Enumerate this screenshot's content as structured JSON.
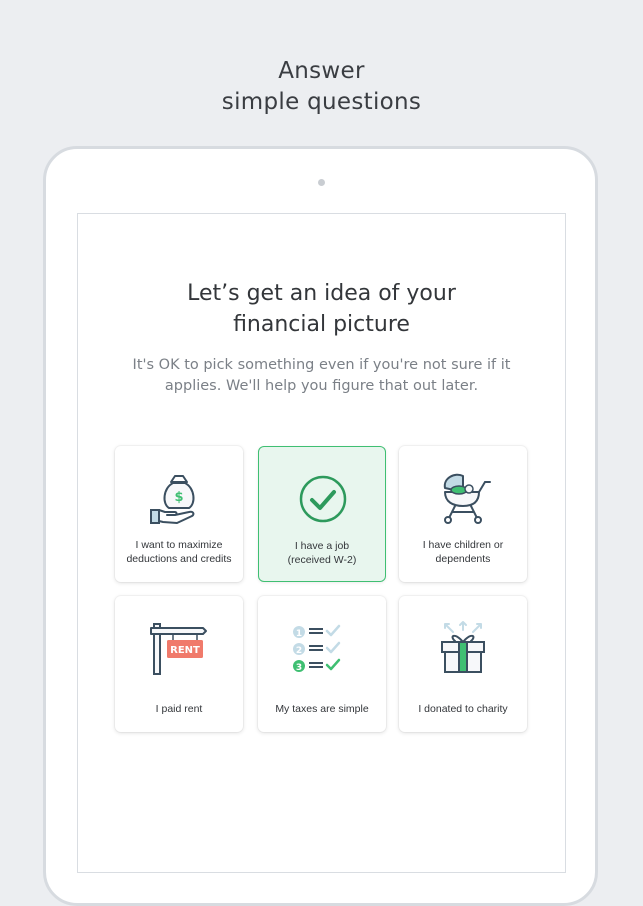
{
  "promo": {
    "title_line1": "Answer",
    "title_line2": "simple questions"
  },
  "screen": {
    "heading_line1": "Let’s get an idea of your",
    "heading_line2": "financial picture",
    "subtext_line1": "It's OK to pick something even if you're not sure if it",
    "subtext_line2": "applies. We'll help you figure that out later."
  },
  "options": [
    {
      "icon": "money-bag-hand-icon",
      "label_line1": "I want to maximize",
      "label_line2": "deductions and credits",
      "selected": false
    },
    {
      "icon": "checkmark-circle-icon",
      "label_line1": "I have a job",
      "label_line2": "(received W-2)",
      "selected": true
    },
    {
      "icon": "baby-stroller-icon",
      "label_line1": "I have children or",
      "label_line2": "dependents",
      "selected": false
    },
    {
      "icon": "rent-sign-icon",
      "label_line1": "I paid rent",
      "sign_text": "RENT",
      "selected": false
    },
    {
      "icon": "numbered-checklist-icon",
      "label_line1": "My taxes are simple",
      "list_numbers": [
        "1",
        "2",
        "3"
      ],
      "selected": false
    },
    {
      "icon": "gift-box-icon",
      "label_line1": "I donated to charity",
      "selected": false
    }
  ],
  "colors": {
    "accent_green": "#3fbf72",
    "selected_bg": "#e8f6ee",
    "rent_sign": "#f07a6b",
    "light_blue": "#c3dbe6"
  }
}
